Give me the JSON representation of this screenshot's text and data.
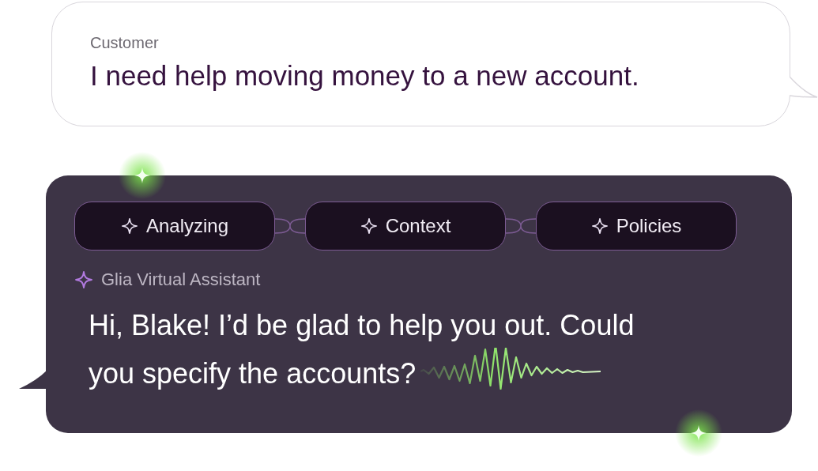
{
  "customer": {
    "label": "Customer",
    "message": "I need help moving money to a new account."
  },
  "assistant": {
    "chips": [
      {
        "label": "Analyzing"
      },
      {
        "label": "Context"
      },
      {
        "label": "Policies"
      }
    ],
    "name": "Glia Virtual Assistant",
    "message_lines": [
      "Hi, Blake! I’d be glad to help you out. Could",
      "you specify the accounts?"
    ]
  }
}
